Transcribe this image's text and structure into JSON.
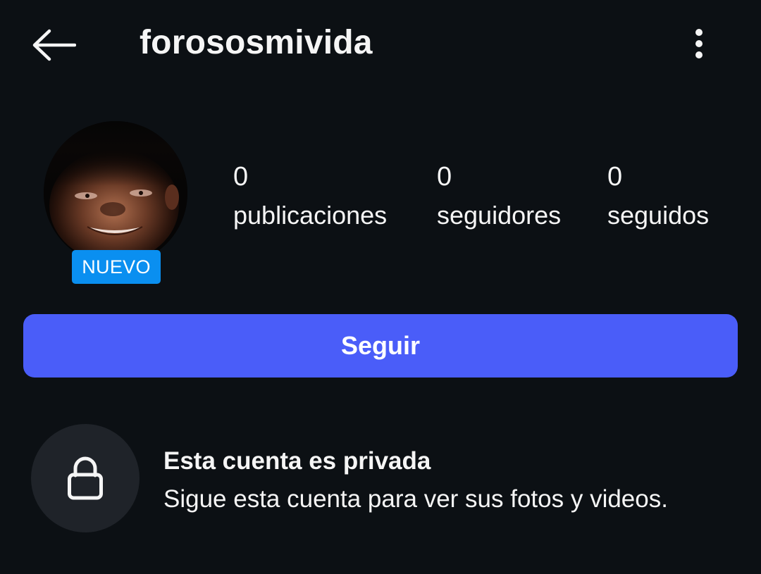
{
  "header": {
    "username": "forososmivida",
    "back_icon": "arrow-left-icon",
    "more_icon": "vertical-dots-icon"
  },
  "profile": {
    "badge": "NUEVO",
    "avatar_icon": "profile-photo"
  },
  "stats": [
    {
      "value": "0",
      "label": "publicaciones"
    },
    {
      "value": "0",
      "label": "seguidores"
    },
    {
      "value": "0",
      "label": "seguidos"
    }
  ],
  "actions": {
    "follow_label": "Seguir"
  },
  "private_notice": {
    "icon": "lock-icon",
    "title": "Esta cuenta es privada",
    "description": "Sigue esta cuenta para ver sus fotos y videos."
  },
  "colors": {
    "background": "#0c1014",
    "primary_button": "#4a5df9",
    "badge": "#0a8ff0",
    "lock_circle": "#1f2329"
  }
}
